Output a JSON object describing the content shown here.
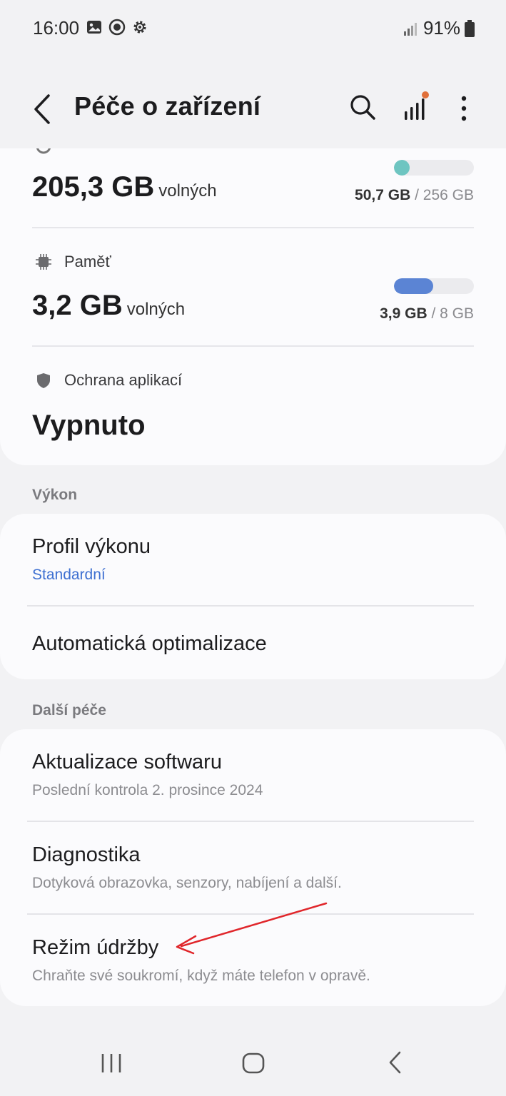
{
  "status_bar": {
    "time": "16:00",
    "battery": "91%",
    "left_icons": [
      "gallery-icon",
      "record-icon",
      "settings-icon"
    ],
    "right_icons": [
      "signal-icon",
      "battery-icon"
    ]
  },
  "app_bar": {
    "title": "Péče o zařízení",
    "icons": [
      "back-arrow-icon",
      "search-icon",
      "stats-icon",
      "more-icon"
    ],
    "notification_dot_color": "#e0703a"
  },
  "storage": {
    "free_value": "205,3 GB",
    "free_unit": "volných",
    "used": "50,7 GB",
    "separator": " / ",
    "total": "256 GB",
    "fill_fraction": 0.2,
    "fill_color": "#6ec5c1"
  },
  "memory": {
    "label": "Paměť",
    "free_value": "3,2 GB",
    "free_unit": "volných",
    "used": "3,9 GB",
    "separator": " / ",
    "total": "8 GB",
    "fill_fraction": 0.49,
    "fill_color": "#5b84d4"
  },
  "app_protection": {
    "label": "Ochrana aplikací",
    "value": "Vypnuto"
  },
  "performance": {
    "header": "Výkon",
    "items": [
      {
        "title": "Profil výkonu",
        "subtitle": "Standardní"
      },
      {
        "title": "Automatická optimalizace"
      }
    ]
  },
  "other_care": {
    "header": "Další péče",
    "items": [
      {
        "title": "Aktualizace softwaru",
        "subtitle": "Poslední kontrola 2. prosince 2024"
      },
      {
        "title": "Diagnostika",
        "subtitle": "Dotyková obrazovka, senzory, nabíjení a další."
      },
      {
        "title": "Režim údržby",
        "subtitle": "Chraňte své soukromí, když máte telefon v opravě."
      }
    ]
  },
  "annotation_color": "#e0262b",
  "nav_bar": {
    "icons": [
      "recent-apps-icon",
      "home-icon",
      "back-nav-icon"
    ]
  }
}
